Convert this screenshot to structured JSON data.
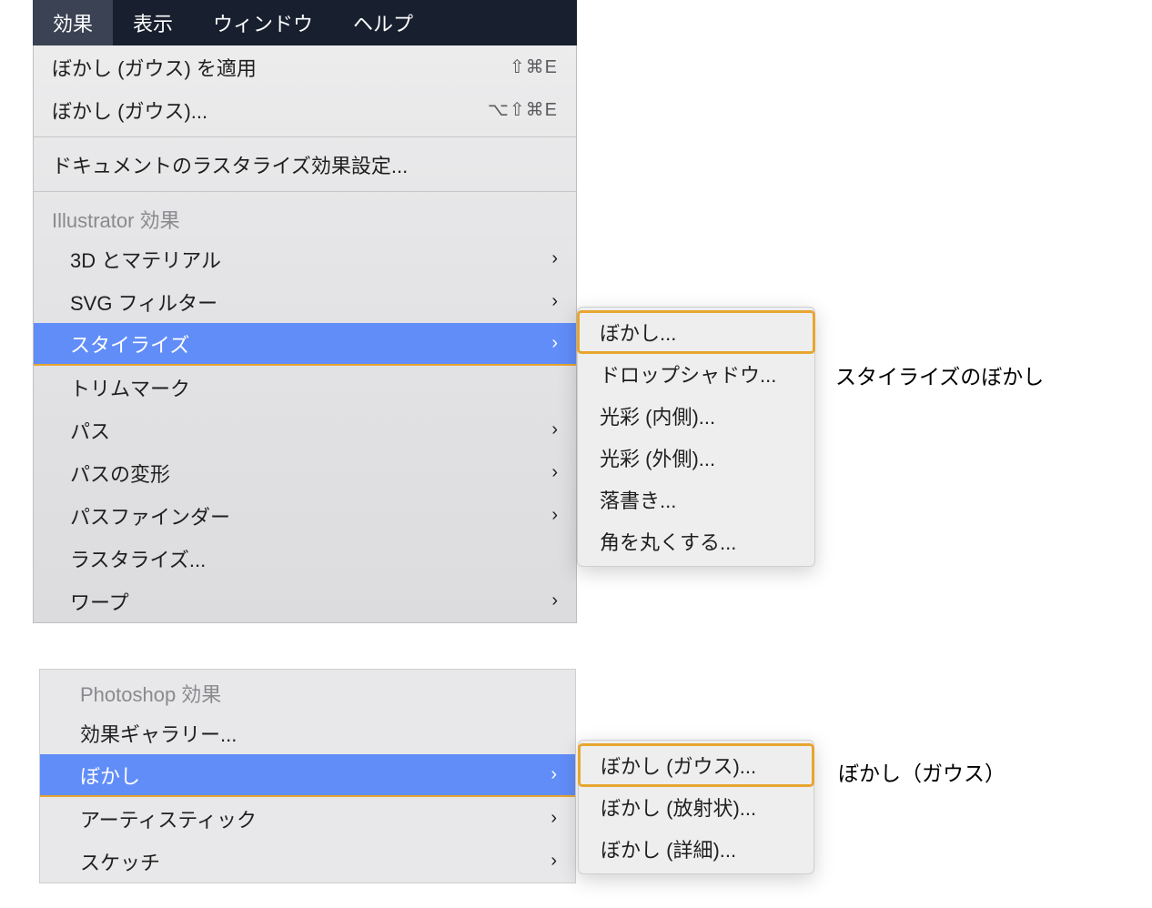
{
  "menubar": {
    "items": [
      {
        "label": "効果",
        "selected": true
      },
      {
        "label": "表示",
        "selected": false
      },
      {
        "label": "ウィンドウ",
        "selected": false
      },
      {
        "label": "ヘルプ",
        "selected": false
      }
    ]
  },
  "effect_menu": {
    "apply_last": {
      "label": "ぼかし (ガウス) を適用",
      "shortcut": "⇧⌘E"
    },
    "last_options": {
      "label": "ぼかし (ガウス)...",
      "shortcut": "⌥⇧⌘E"
    },
    "doc_raster": {
      "label": "ドキュメントのラスタライズ効果設定..."
    },
    "illustrator_header": "Illustrator 効果",
    "illustrator_items": [
      {
        "label": "3D とマテリアル",
        "submenu": true
      },
      {
        "label": "SVG フィルター",
        "submenu": true
      },
      {
        "label": "スタイライズ",
        "submenu": true,
        "highlight": true
      },
      {
        "label": "トリムマーク",
        "submenu": false
      },
      {
        "label": "パス",
        "submenu": true
      },
      {
        "label": "パスの変形",
        "submenu": true
      },
      {
        "label": "パスファインダー",
        "submenu": true
      },
      {
        "label": "ラスタライズ...",
        "submenu": false
      },
      {
        "label": "ワープ",
        "submenu": true
      }
    ],
    "stylize_submenu": [
      {
        "label": "ぼかし...",
        "boxed": true
      },
      {
        "label": "ドロップシャドウ..."
      },
      {
        "label": "光彩 (内側)..."
      },
      {
        "label": "光彩 (外側)..."
      },
      {
        "label": "落書き..."
      },
      {
        "label": "角を丸くする..."
      }
    ]
  },
  "photoshop_menu": {
    "header": "Photoshop 効果",
    "items": [
      {
        "label": "効果ギャラリー...",
        "submenu": false
      },
      {
        "label": "ぼかし",
        "submenu": true,
        "highlight": true
      },
      {
        "label": "アーティスティック",
        "submenu": true
      },
      {
        "label": "スケッチ",
        "submenu": true
      }
    ],
    "blur_submenu": [
      {
        "label": "ぼかし (ガウス)...",
        "boxed": true
      },
      {
        "label": "ぼかし (放射状)..."
      },
      {
        "label": "ぼかし (詳細)..."
      }
    ]
  },
  "annotations": {
    "stylize_blur": "スタイライズのぼかし",
    "gaussian_blur": "ぼかし（ガウス）"
  }
}
